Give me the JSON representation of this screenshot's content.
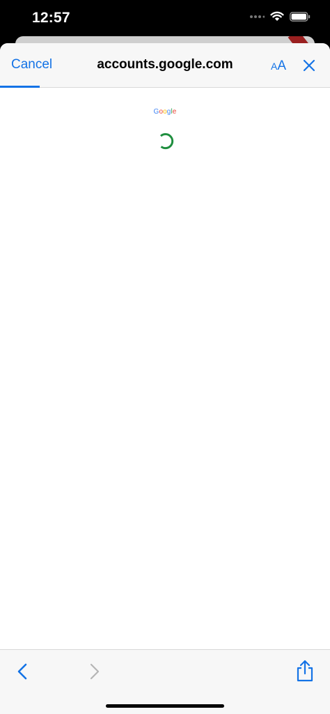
{
  "status_bar": {
    "time": "12:57"
  },
  "browser": {
    "cancel_label": "Cancel",
    "url": "accounts.google.com",
    "text_size_small": "A",
    "text_size_large": "A",
    "accent_color": "#1473e6"
  },
  "page": {
    "logo_letters": [
      "G",
      "o",
      "o",
      "g",
      "l",
      "e"
    ],
    "logo_colors": [
      "#4285f4",
      "#ea4335",
      "#fbbc05",
      "#4285f4",
      "#34a853",
      "#ea4335"
    ],
    "spinner_color": "#1e8e3e",
    "status": "loading"
  },
  "toolbar": {
    "back_icon": "chevron-left-icon",
    "forward_icon": "chevron-right-icon",
    "share_icon": "share-icon"
  }
}
